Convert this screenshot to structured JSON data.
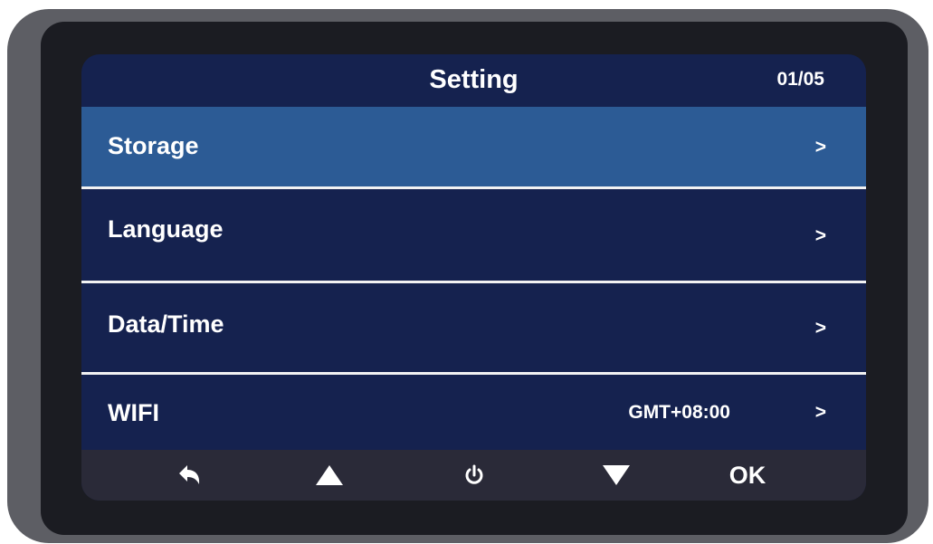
{
  "screen": {
    "title": "Setting",
    "page_counter": "01/05"
  },
  "menu": {
    "items": [
      {
        "label": "Storage",
        "value": "",
        "chevron": ">",
        "selected": true
      },
      {
        "label": "Language",
        "value": "",
        "chevron": ">",
        "selected": false
      },
      {
        "label": "Data/Time",
        "value": "",
        "chevron": ">",
        "selected": false
      },
      {
        "label": "WIFI",
        "value": "GMT+08:00",
        "chevron": ">",
        "selected": false
      }
    ]
  },
  "buttons": {
    "back_icon": "back-arrow-icon",
    "up_icon": "up-triangle-icon",
    "power_icon": "power-icon",
    "down_icon": "down-triangle-icon",
    "ok_label": "OK"
  },
  "colors": {
    "screen_background": "#15224f",
    "selected_row": "#2c5b95",
    "button_bar": "#2a2a38",
    "divider": "#f2f2f2"
  }
}
